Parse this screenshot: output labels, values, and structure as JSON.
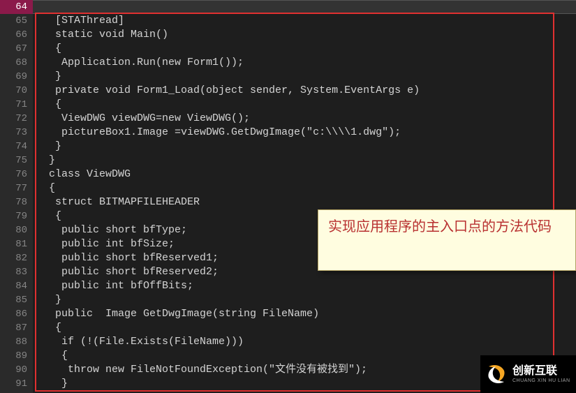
{
  "lines": [
    {
      "num": 64,
      "text": "",
      "hl": true
    },
    {
      "num": 65,
      "text": "  [STAThread]"
    },
    {
      "num": 66,
      "text": "  static void Main()"
    },
    {
      "num": 67,
      "text": "  {"
    },
    {
      "num": 68,
      "text": "   Application.Run(new Form1());"
    },
    {
      "num": 69,
      "text": "  }"
    },
    {
      "num": 70,
      "text": "  private void Form1_Load(object sender, System.EventArgs e)"
    },
    {
      "num": 71,
      "text": "  {"
    },
    {
      "num": 72,
      "text": "   ViewDWG viewDWG=new ViewDWG();"
    },
    {
      "num": 73,
      "text": "   pictureBox1.Image =viewDWG.GetDwgImage(\"c:\\\\\\\\1.dwg\");"
    },
    {
      "num": 74,
      "text": "  }"
    },
    {
      "num": 75,
      "text": " }"
    },
    {
      "num": 76,
      "text": " class ViewDWG"
    },
    {
      "num": 77,
      "text": " {"
    },
    {
      "num": 78,
      "text": "  struct BITMAPFILEHEADER"
    },
    {
      "num": 79,
      "text": "  {"
    },
    {
      "num": 80,
      "text": "   public short bfType;"
    },
    {
      "num": 81,
      "text": "   public int bfSize;"
    },
    {
      "num": 82,
      "text": "   public short bfReserved1;"
    },
    {
      "num": 83,
      "text": "   public short bfReserved2;"
    },
    {
      "num": 84,
      "text": "   public int bfOffBits;"
    },
    {
      "num": 85,
      "text": "  }"
    },
    {
      "num": 86,
      "text": "  public  Image GetDwgImage(string FileName)"
    },
    {
      "num": 87,
      "text": "  {"
    },
    {
      "num": 88,
      "text": "   if (!(File.Exists(FileName)))"
    },
    {
      "num": 89,
      "text": "   {"
    },
    {
      "num": 90,
      "text": "    throw new FileNotFoundException(\"文件没有被找到\");"
    },
    {
      "num": 91,
      "text": "   }"
    }
  ],
  "tooltip": {
    "text": "实现应用程序的主入口点的方法代码"
  },
  "logo": {
    "cn": "创新互联",
    "en": "CHUANG XIN HU LIAN"
  }
}
